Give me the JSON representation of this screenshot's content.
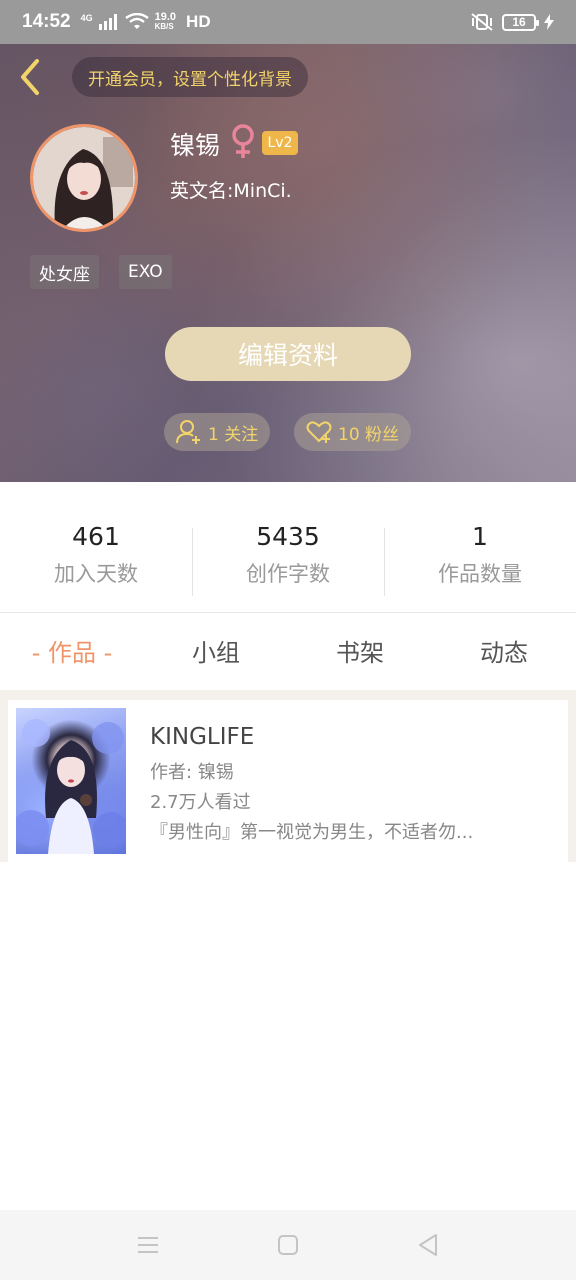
{
  "status_bar": {
    "time": "14:52",
    "network": "4G",
    "speed": "19.0",
    "speed_unit": "KB/S",
    "hd": "HD",
    "battery": "16"
  },
  "header": {
    "vip_banner": "开通会员，设置个性化背景",
    "username": "镍锡",
    "gender_symbol": "♀",
    "level": "Lv2",
    "english_name": "英文名:MinCi.",
    "tags": [
      "处女座",
      "EXO"
    ],
    "edit_button": "编辑资料",
    "following": "1 关注",
    "fans": "10 粉丝"
  },
  "stats": [
    {
      "value": "461",
      "label": "加入天数"
    },
    {
      "value": "5435",
      "label": "创作字数"
    },
    {
      "value": "1",
      "label": "作品数量"
    }
  ],
  "tabs": [
    "- 作品 -",
    "小组",
    "书架",
    "动态"
  ],
  "work": {
    "title": "KINGLIFE",
    "author": "作者: 镍锡",
    "views": "2.7万人看过",
    "desc": "『男性向』第一视觉为男生，不适者勿..."
  },
  "colors": {
    "accent": "#f0956a",
    "vip_text": "#f3d46a",
    "level_badge": "#efb64a",
    "edit_button": "#e6d8b5"
  }
}
